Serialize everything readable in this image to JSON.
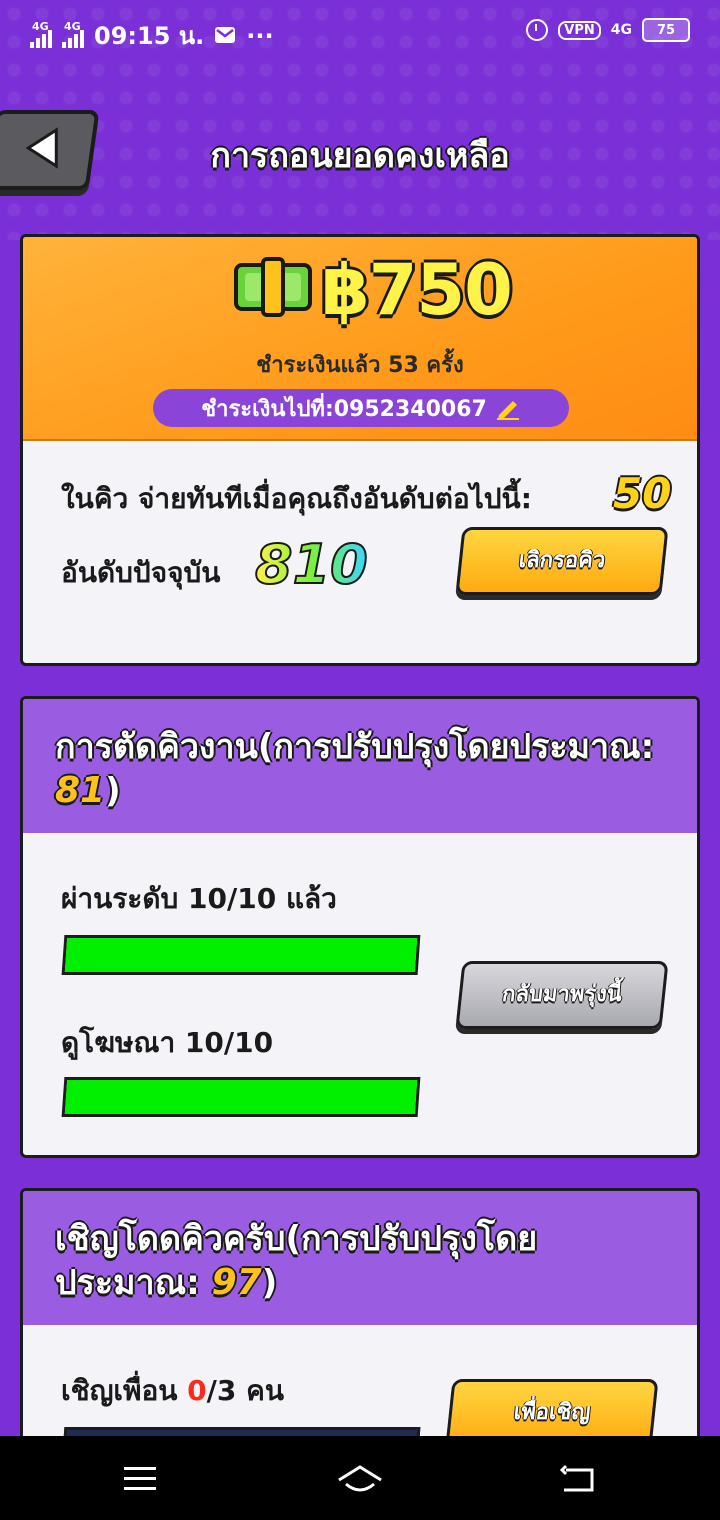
{
  "status": {
    "time": "09:15 น.",
    "network1": "4G",
    "network2": "4G",
    "network3": "4G",
    "vpn": "VPN",
    "battery": "75",
    "more": "···"
  },
  "header": {
    "title": "การถอนยอดคงเหลือ"
  },
  "balance": {
    "amount": "฿750",
    "paid_count": "ชำระเงินแล้ว 53 ครั้ง",
    "pay_to": "ชำระเงินไปที่:0952340067"
  },
  "queue": {
    "text": "ในคิว จ่ายทันทีเมื่อคุณถึงอันดับต่อไปนี้:",
    "target": "50",
    "rank_label": "อันดับปัจจุบัน",
    "rank": "810",
    "cancel_button": "เลิกรอคิว"
  },
  "skip_card": {
    "title": "การตัดคิวงาน(การปรับปรุงโดยประมาณ:",
    "estimate": "81",
    "close_paren": ")",
    "task1": {
      "label": "ผ่านระดับ 10/10 แล้ว",
      "progress": 1.0
    },
    "task2": {
      "label": "ดูโฆษณา 10/10",
      "progress": 1.0
    },
    "button": "กลับมาพรุ่งนี้"
  },
  "invite_card": {
    "title": "เชิญโดดคิวครับ(การปรับปรุงโดยประมาณ:",
    "estimate": "97",
    "close_paren": ")",
    "label_prefix": "เชิญเพื่อน ",
    "count": "0",
    "label_suffix": "/3 คน",
    "count_color": "#ff2a1a",
    "progress": 0.0,
    "button": "เพื่อเชิญ"
  },
  "colors": {
    "background": "#7a30d6",
    "progress_fill": "#00f000",
    "accent_yellow": "#ffd21a"
  }
}
